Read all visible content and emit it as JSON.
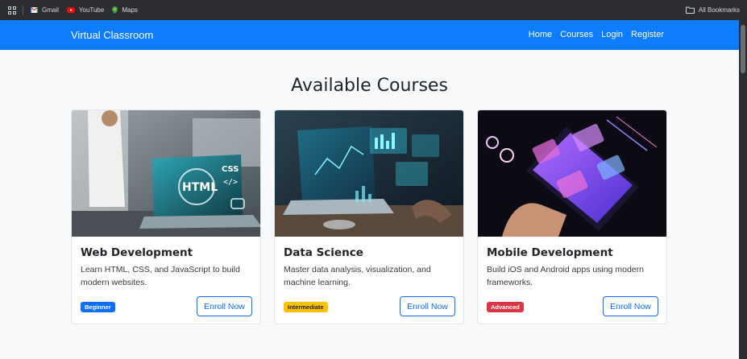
{
  "bookmarks": {
    "items": [
      {
        "label": "Gmail"
      },
      {
        "label": "YouTube"
      },
      {
        "label": "Maps"
      }
    ],
    "all_label": "All Bookmarks"
  },
  "navbar": {
    "brand": "Virtual Classroom",
    "links": [
      "Home",
      "Courses",
      "Login",
      "Register"
    ],
    "color": "#0d7cff"
  },
  "main": {
    "title": "Available Courses",
    "courses": [
      {
        "title": "Web Development",
        "description": "Learn HTML, CSS, and JavaScript to build modern websites.",
        "level": "Beginner",
        "level_color": "#0d6efd",
        "enroll_label": "Enroll Now",
        "image": "laptop-with-html-css-icons"
      },
      {
        "title": "Data Science",
        "description": "Master data analysis, visualization, and machine learning.",
        "level": "Intermediate",
        "level_color": "#ffc107",
        "enroll_label": "Enroll Now",
        "image": "laptop-with-holographic-charts"
      },
      {
        "title": "Mobile Development",
        "description": "Build iOS and Android apps using modern frameworks.",
        "level": "Advanced",
        "level_color": "#dc3545",
        "enroll_label": "Enroll Now",
        "image": "hand-holding-phone-with-app-screens"
      }
    ]
  }
}
